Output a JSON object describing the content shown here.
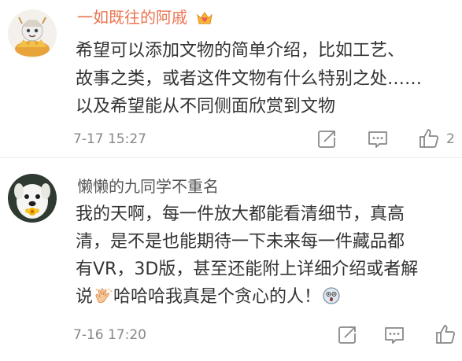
{
  "comments": [
    {
      "username": "一如既往的阿戚",
      "vip_badge_icon": "vip-crown-heart-icon",
      "avatar_icon": "cartoon-character-avatar",
      "lines": [
        "希望可以添加文物的简单介绍，比如工艺、",
        "故事之类，或者这件文物有什么特别之处……",
        "以及希望能从不同侧面欣赏到文物"
      ],
      "timestamp": "7-17 15:27",
      "like_count": "2",
      "icons": [
        "repost-icon",
        "comment-icon",
        "like-icon"
      ]
    },
    {
      "username": "懒懒的九同学不重名",
      "avatar_icon": "white-dog-with-flower-avatar",
      "lines": [
        "我的天啊，每一件放大都能看清细节，真高",
        "清，是不是也能期待一下未来每一件藏品都",
        "有VR，3D版，甚至还能附上详细介绍或者解",
        "说",
        "哈哈哈我真是个贪心的人！"
      ],
      "inline_emojis": [
        "clapping-hands-emoji",
        "surprised-face-emoji"
      ],
      "timestamp": "7-16 17:20",
      "like_count": "",
      "icons": [
        "repost-icon",
        "comment-icon",
        "like-icon"
      ]
    }
  ],
  "colors": {
    "vip_username": "#eb7350",
    "username": "#555555",
    "body_text": "#333333",
    "meta_text": "#888888",
    "icon_stroke": "#888888"
  }
}
